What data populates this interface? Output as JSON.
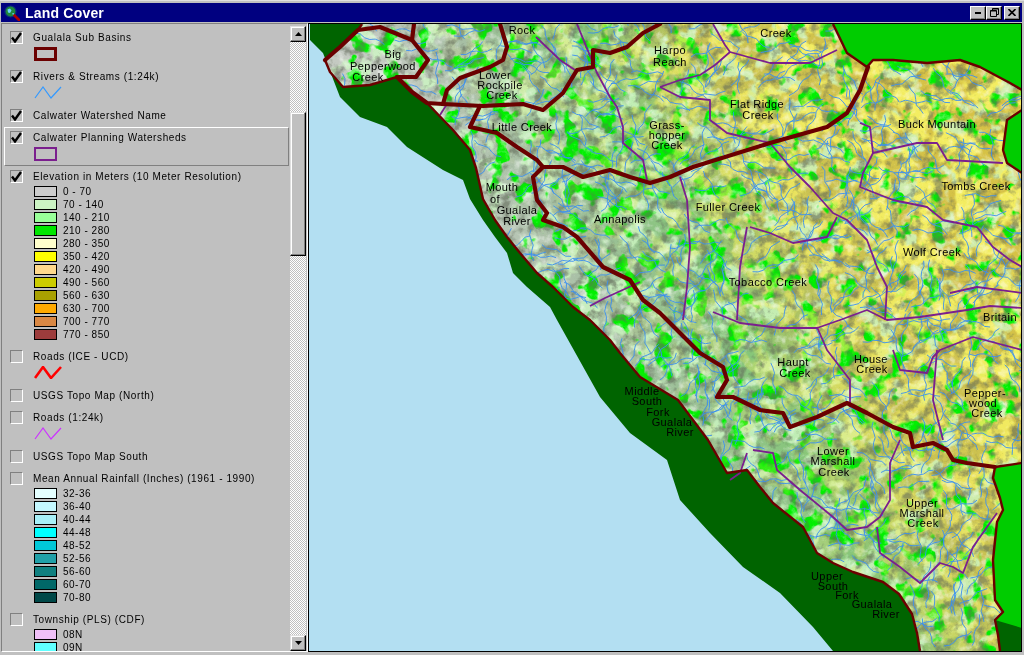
{
  "window": {
    "title": "Land Cover"
  },
  "legend": {
    "layers": [
      {
        "label": "Gualala Sub Basins",
        "checked": true,
        "selected": false,
        "symbol": {
          "kind": "thick_box",
          "color": "#6b0000"
        }
      },
      {
        "label": "Rivers & Streams (1:24k)",
        "checked": true,
        "selected": false,
        "symbol": {
          "kind": "line",
          "color": "#3399ff"
        }
      },
      {
        "label": "Calwater Watershed Name",
        "checked": true,
        "selected": false
      },
      {
        "label": "Calwater Planning Watersheds",
        "checked": true,
        "selected": true,
        "symbol": {
          "kind": "box",
          "color": "#7b1f8e"
        }
      },
      {
        "label": "Elevation in Meters (10 Meter Resolution)",
        "checked": true,
        "selected": false,
        "classes": [
          {
            "label": "0 - 70",
            "color": "#cccccc"
          },
          {
            "label": "70 - 140",
            "color": "#ccf4c4"
          },
          {
            "label": "140 - 210",
            "color": "#99ff99"
          },
          {
            "label": "210 - 280",
            "color": "#00e600"
          },
          {
            "label": "280 - 350",
            "color": "#ffffcc"
          },
          {
            "label": "350 - 420",
            "color": "#ffff00"
          },
          {
            "label": "420 - 490",
            "color": "#ffd98c"
          },
          {
            "label": "490 - 560",
            "color": "#cccc00"
          },
          {
            "label": "560 - 630",
            "color": "#a8a000"
          },
          {
            "label": "630 - 700",
            "color": "#ffaa00"
          },
          {
            "label": "700 - 770",
            "color": "#d98844"
          },
          {
            "label": "770 - 850",
            "color": "#9c3c3c"
          }
        ]
      },
      {
        "label": "Roads (ICE - UCD)",
        "checked": false,
        "selected": false,
        "symbol": {
          "kind": "thick_line",
          "color": "#ff0000"
        }
      },
      {
        "label": "USGS Topo Map (North)",
        "checked": false,
        "selected": false
      },
      {
        "label": "Roads (1:24k)",
        "checked": false,
        "selected": false,
        "symbol": {
          "kind": "line",
          "color": "#cc33ff"
        }
      },
      {
        "label": "USGS Topo Map South",
        "checked": false,
        "selected": false
      },
      {
        "label": "Mean Annual Rainfall (Inches) (1961 - 1990)",
        "checked": false,
        "selected": false,
        "classes": [
          {
            "label": "32-36",
            "color": "#e4ffff"
          },
          {
            "label": "36-40",
            "color": "#c4f8ff"
          },
          {
            "label": "40-44",
            "color": "#a8f0f8"
          },
          {
            "label": "44-48",
            "color": "#00ffff"
          },
          {
            "label": "48-52",
            "color": "#00c8d8"
          },
          {
            "label": "52-56",
            "color": "#20a0a8"
          },
          {
            "label": "56-60",
            "color": "#108080"
          },
          {
            "label": "60-70",
            "color": "#006868"
          },
          {
            "label": "70-80",
            "color": "#004848"
          }
        ]
      },
      {
        "label": "Township (PLS) (CDF)",
        "checked": false,
        "selected": false,
        "classes": [
          {
            "label": "08N",
            "color": "#f0c0f8"
          },
          {
            "label": "09N",
            "color": "#60ffff"
          }
        ]
      }
    ]
  },
  "map": {
    "labels": [
      {
        "lines": [
          "Rock"
        ]
      },
      {
        "lines": [
          "Creek"
        ]
      },
      {
        "lines": [
          "Harpo",
          "Reach"
        ]
      },
      {
        "lines": [
          "Big",
          "Pepperwood",
          "Creek"
        ]
      },
      {
        "lines": [
          "Lower",
          "Rockpile",
          "Creek"
        ]
      },
      {
        "lines": [
          "Little Creek"
        ]
      },
      {
        "lines": [
          "Grass-",
          "hopper",
          "Creek"
        ]
      },
      {
        "lines": [
          "Flat Ridge",
          "Creek"
        ]
      },
      {
        "lines": [
          "Buck Mountain"
        ]
      },
      {
        "lines": [
          "Tombs Creek"
        ]
      },
      {
        "lines": [
          "Mouth",
          "of",
          "Gualala",
          "River"
        ]
      },
      {
        "lines": [
          "Annapolis"
        ]
      },
      {
        "lines": [
          "Fuller Creek"
        ]
      },
      {
        "lines": [
          "Wolf Creek"
        ]
      },
      {
        "lines": [
          "Tobacco Creek"
        ]
      },
      {
        "lines": [
          "Britain"
        ]
      },
      {
        "lines": [
          "Haupt",
          "Creek"
        ]
      },
      {
        "lines": [
          "House",
          "Creek"
        ]
      },
      {
        "lines": [
          "Middle",
          "South",
          "Fork",
          "Gualala",
          "River"
        ]
      },
      {
        "lines": [
          "Pepper-",
          "wood",
          "Creek"
        ]
      },
      {
        "lines": [
          "Lower",
          "Marshall",
          "Creek"
        ]
      },
      {
        "lines": [
          "Upper",
          "Marshall",
          "Creek"
        ]
      },
      {
        "lines": [
          "Upper",
          "South",
          "Fork",
          "Gualala",
          "River"
        ]
      }
    ]
  }
}
